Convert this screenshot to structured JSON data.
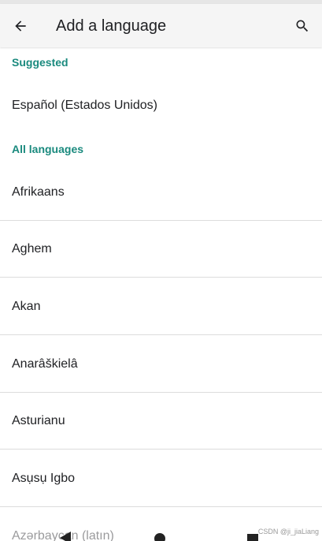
{
  "app_bar": {
    "title": "Add a language",
    "back_icon": "arrow-back-icon",
    "search_icon": "search-icon"
  },
  "sections": {
    "suggested": {
      "header": "Suggested",
      "items": [
        "Español (Estados Unidos)"
      ]
    },
    "all_languages": {
      "header": "All languages",
      "items": [
        "Afrikaans",
        "Aghem",
        "Akan",
        "Anarâškielâ",
        "Asturianu",
        "Asụsụ Igbo",
        "Azərbaycan (latın)"
      ]
    }
  },
  "nav_bar": {
    "back_icon": "nav-back-icon",
    "home_icon": "nav-home-icon",
    "recents_icon": "nav-recents-icon"
  },
  "watermark": "CSDN @ji_jiaLiang",
  "colors": {
    "accent": "#1a8a7e",
    "app_bar_bg": "#f5f5f5",
    "text": "#202124",
    "divider": "#dcdcdc"
  }
}
